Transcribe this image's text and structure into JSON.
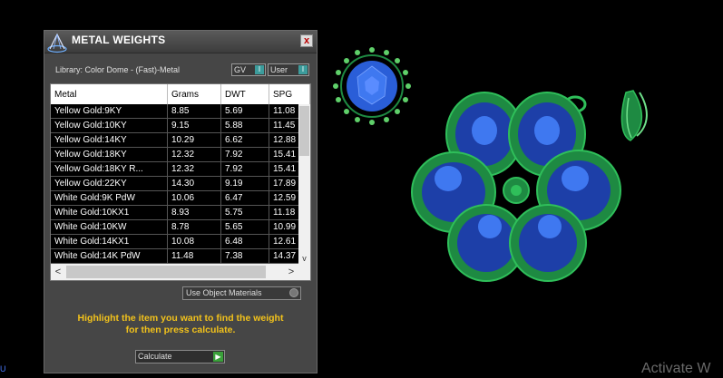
{
  "window": {
    "title": "METAL WEIGHTS",
    "close_label": "x"
  },
  "library_label": "Library: Color Dome - (Fast)-Metal",
  "toggles": [
    {
      "label": "GV",
      "indicator": "I"
    },
    {
      "label": "User",
      "indicator": "I"
    }
  ],
  "table": {
    "columns": [
      "Metal",
      "Grams",
      "DWT",
      "SPG"
    ],
    "rows": [
      [
        "Yellow Gold:9KY",
        "8.85",
        "5.69",
        "11.08"
      ],
      [
        "Yellow Gold:10KY",
        "9.15",
        "5.88",
        "11.45"
      ],
      [
        "Yellow Gold:14KY",
        "10.29",
        "6.62",
        "12.88"
      ],
      [
        "Yellow Gold:18KY",
        "12.32",
        "7.92",
        "15.41"
      ],
      [
        "Yellow Gold:18KY R...",
        "12.32",
        "7.92",
        "15.41"
      ],
      [
        "Yellow Gold:22KY",
        "14.30",
        "9.19",
        "17.89"
      ],
      [
        "White Gold:9K PdW",
        "10.06",
        "6.47",
        "12.59"
      ],
      [
        "White Gold:10KX1",
        "8.93",
        "5.75",
        "11.18"
      ],
      [
        "White Gold:10KW",
        "8.78",
        "5.65",
        "10.99"
      ],
      [
        "White Gold:14KX1",
        "10.08",
        "6.48",
        "12.61"
      ],
      [
        "White Gold:14K PdW",
        "11.48",
        "7.38",
        "14.37"
      ]
    ]
  },
  "scroll": {
    "left": "<",
    "right": ">",
    "down": "v"
  },
  "use_object_materials": "Use Object Materials",
  "instructions": {
    "line1": "Highlight the item you want to find the weight",
    "line2": "for then press calculate."
  },
  "calculate_label": "Calculate",
  "watermark": "Activate W",
  "edge_glyph": "U",
  "colors": {
    "accent_yellow": "#f2c21b",
    "metal_green": "#1f9a4a",
    "stone_blue": "#2a5ed8"
  }
}
